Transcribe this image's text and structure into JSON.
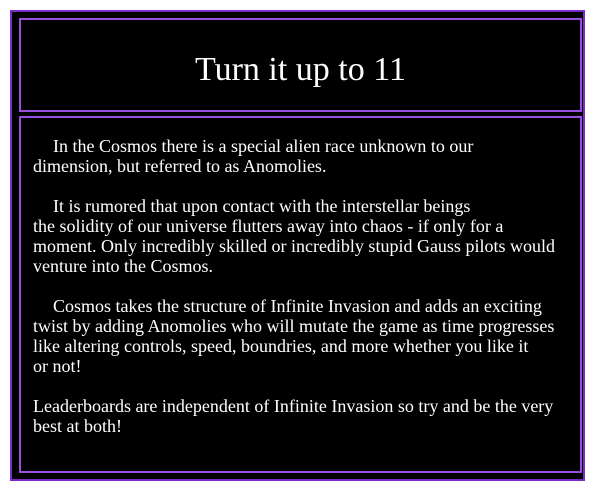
{
  "title": "Turn it up to 11",
  "paragraphs": [
    {
      "lines": [
        "In the Cosmos there is a special alien race unknown to our",
        "dimension, but referred to as Anomolies."
      ]
    },
    {
      "lines": [
        "It is rumored that upon contact with the interstellar beings",
        "the solidity of our universe flutters away into chaos - if only for a",
        "moment. Only incredibly skilled or incredibly stupid Gauss pilots would",
        "venture into the Cosmos."
      ]
    },
    {
      "lines": [
        "Cosmos takes the structure of Infinite Invasion and adds an exciting",
        "twist by adding Anomolies who will mutate the game as time progresses",
        "like altering controls, speed, boundries, and more whether you like it",
        "or not!"
      ]
    },
    {
      "lines": [
        "Leaderboards are independent of Infinite Invasion so try and be the very",
        "best at both!"
      ]
    }
  ],
  "colors": {
    "background": "#000000",
    "border": "#9b4fe0",
    "text": "#ffffff"
  }
}
